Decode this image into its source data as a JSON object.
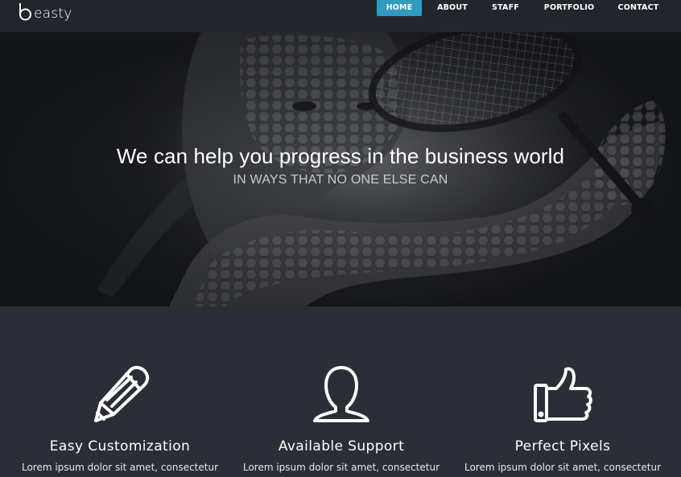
{
  "brand": {
    "name": "easty",
    "icon": "b-letter-logo"
  },
  "nav": {
    "items": [
      {
        "label": "HOME",
        "active": true
      },
      {
        "label": "ABOUT",
        "active": false
      },
      {
        "label": "STAFF",
        "active": false
      },
      {
        "label": "PORTFOLIO",
        "active": false
      },
      {
        "label": "CONTACT",
        "active": false
      }
    ]
  },
  "hero": {
    "title": "We can help you progress in the business world",
    "subtitle": "IN WAYS THAT NO ONE ELSE CAN",
    "image_description_icon": "tennis-player-background"
  },
  "features": [
    {
      "icon": "pencil-icon",
      "title": "Easy Customization",
      "text": "Lorem ipsum dolor sit amet, consectetur"
    },
    {
      "icon": "user-icon",
      "title": "Available Support",
      "text": "Lorem ipsum dolor sit amet, consectetur"
    },
    {
      "icon": "thumbs-up-icon",
      "title": "Perfect Pixels",
      "text": "Lorem ipsum dolor sit amet, consectetur"
    }
  ],
  "colors": {
    "accent": "#2f9bc1",
    "navbar": "#22252b",
    "section": "#2b2e36"
  }
}
